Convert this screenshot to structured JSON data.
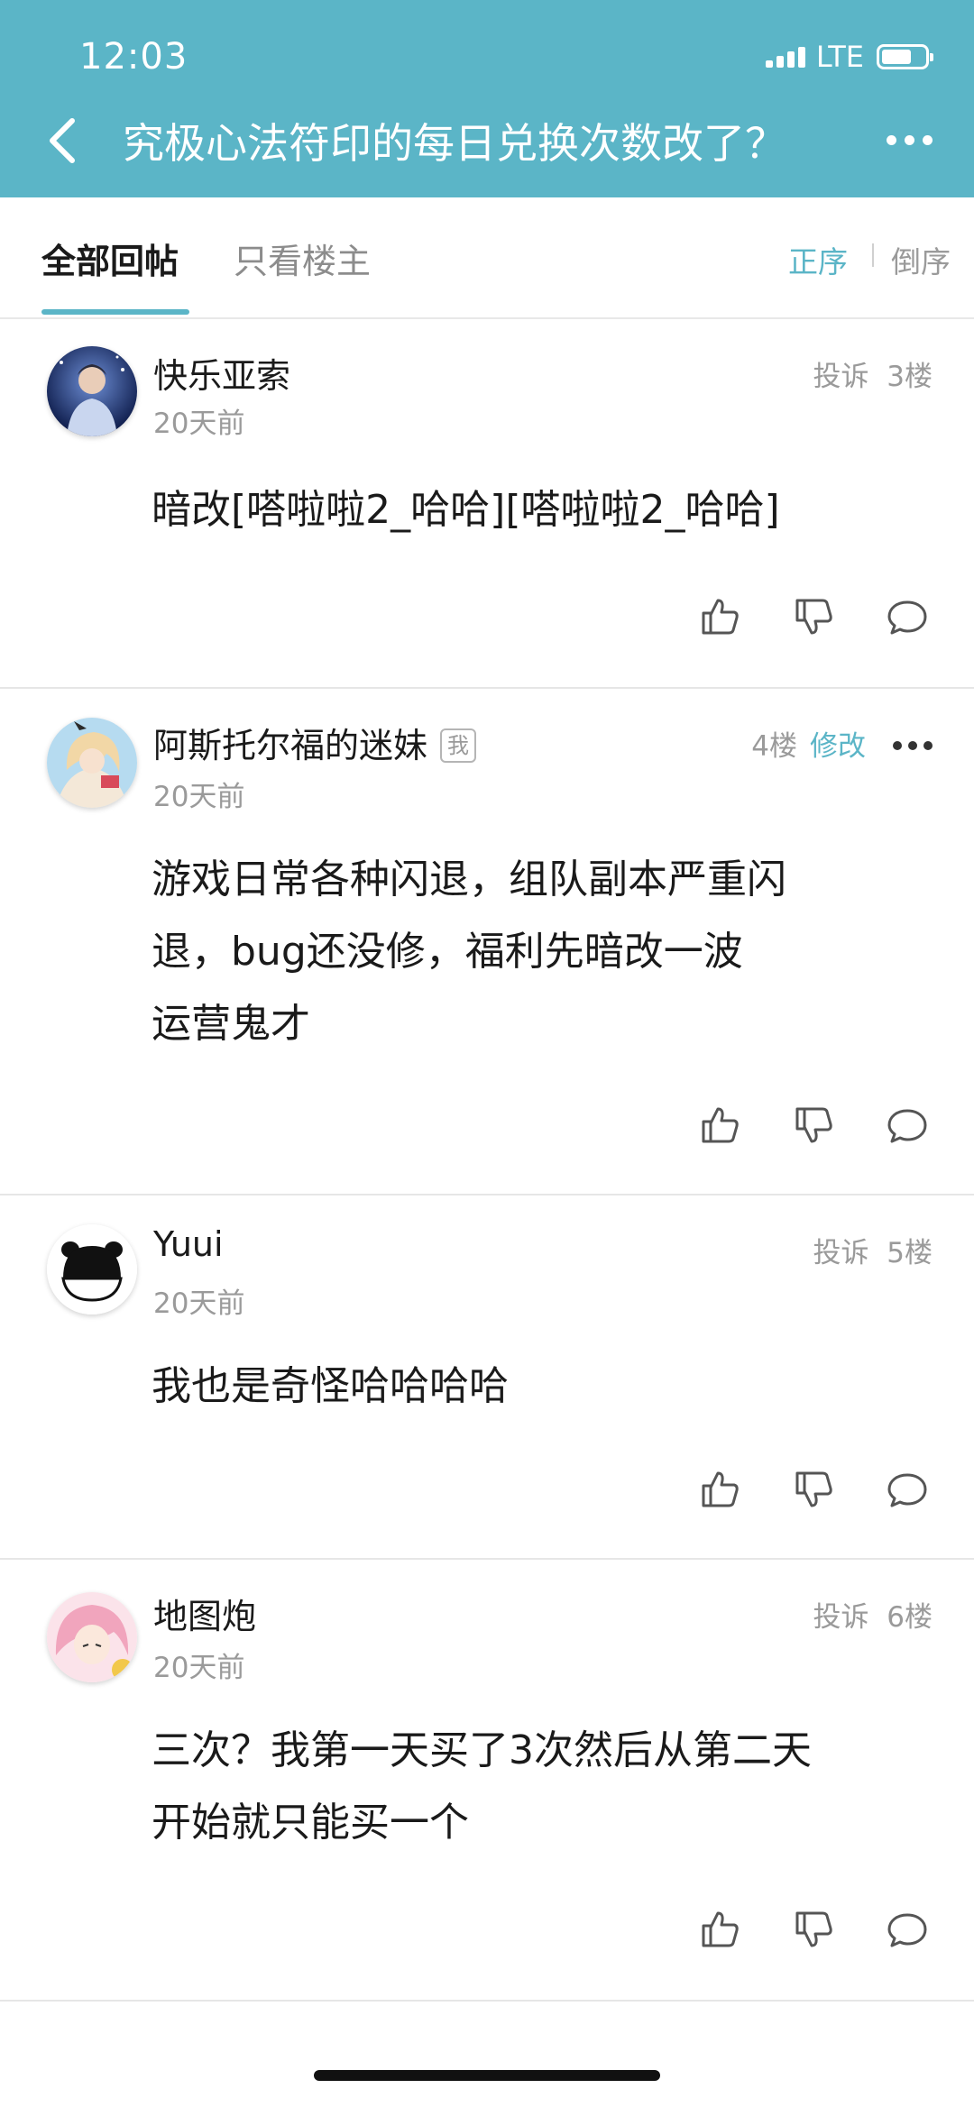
{
  "status": {
    "time": "12:03",
    "network": "LTE"
  },
  "header": {
    "title": "究极心法符印的每日兑换次数改了？"
  },
  "tabs": {
    "all": "全部回帖",
    "op_only": "只看楼主"
  },
  "sort": {
    "asc": "正序",
    "desc": "倒序"
  },
  "posts": [
    {
      "username": "快乐亚索",
      "time": "20天前",
      "report": "投诉",
      "floor": "3楼",
      "content": "暗改[嗒啦啦2_哈哈][嗒啦啦2_哈哈]"
    },
    {
      "username": "阿斯托尔福的迷妹",
      "badge": "我",
      "time": "20天前",
      "floor": "4楼",
      "edit": "修改",
      "content_lines": [
        "游戏日常各种闪退，组队副本严重闪",
        "退，bug还没修，福利先暗改一波",
        "运营鬼才"
      ]
    },
    {
      "username": "Yuui",
      "time": "20天前",
      "report": "投诉",
      "floor": "5楼",
      "content": "我也是奇怪哈哈哈哈"
    },
    {
      "username": "地图炮",
      "time": "20天前",
      "report": "投诉",
      "floor": "6楼",
      "content_lines": [
        "三次？我第一天买了3次然后从第二天",
        "开始就只能买一个"
      ]
    }
  ],
  "colors": {
    "accent": "#5bb5c7",
    "header_bg": "#5bb5c7",
    "muted": "#9a9a9a"
  },
  "icons": [
    "back-arrow-icon",
    "more-icon",
    "thumbs-up-icon",
    "thumbs-down-icon",
    "comment-icon"
  ]
}
